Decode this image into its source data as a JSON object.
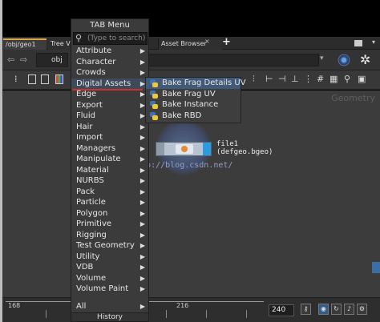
{
  "tabs": {
    "geo": "/obj/geo1",
    "tree": "Tree View",
    "asset": "Asset Browser",
    "close": "×",
    "plus": "+"
  },
  "path": {
    "context": "obj"
  },
  "network": {
    "context_label": "Geometry",
    "watermark": "http://blog.csdn.net/",
    "node": {
      "name": "file1",
      "sub": "(defgeo.bgeo)"
    }
  },
  "timeline": {
    "ticks": [
      "168",
      "216"
    ],
    "frame": "240"
  },
  "tab_menu": {
    "title": "TAB Menu",
    "search_placeholder": "(Type to search)",
    "items": [
      "Attribute",
      "Character",
      "Crowds",
      "Digital Assets",
      "Edge",
      "Export",
      "Fluid",
      "Hair",
      "Import",
      "Managers",
      "Manipulate",
      "Material",
      "NURBS",
      "Pack",
      "Particle",
      "Polygon",
      "Primitive",
      "Rigging",
      "Test Geometry",
      "Utility",
      "VDB",
      "Volume",
      "Volume Paint"
    ],
    "all_label": "All",
    "history_label": "History",
    "active_index": 3,
    "underline_color": "#d03030"
  },
  "submenu": {
    "items": [
      "Bake Frag Details UV",
      "Bake Frag UV",
      "Bake Instance",
      "Bake RBD"
    ],
    "active_index": 0
  },
  "colors": {
    "accent": "#3d74b0",
    "node_output": "#2c9be0"
  }
}
